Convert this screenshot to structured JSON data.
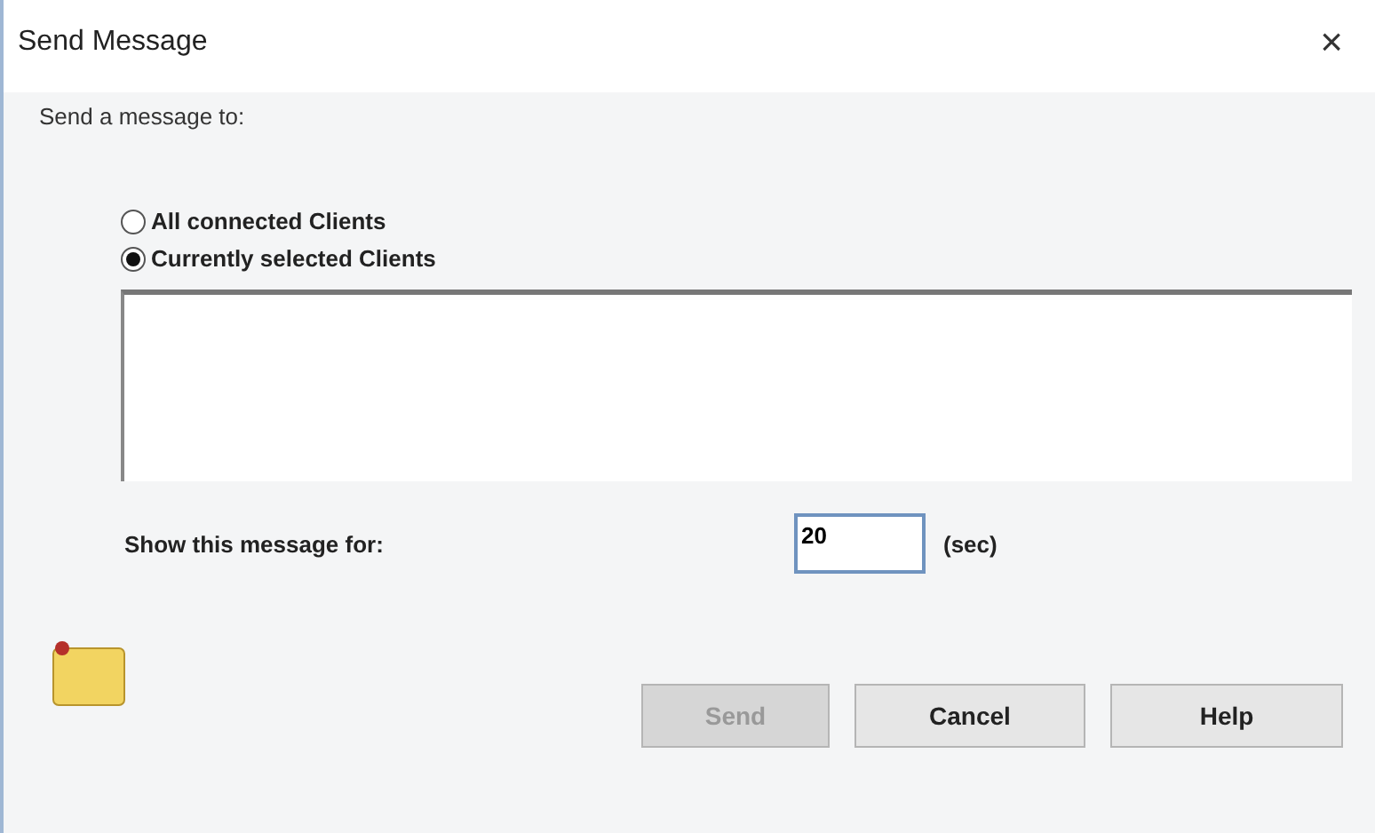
{
  "window": {
    "title": "Send Message",
    "close": "×"
  },
  "prompt": "Send a message to:",
  "recipients": [
    {
      "label": "All connected Clients",
      "selected": false
    },
    {
      "label": "Currently selected Clients",
      "selected": true
    }
  ],
  "duration": {
    "label": "Show this message for:",
    "value": "20",
    "unit": "(sec)"
  },
  "buttons": [
    {
      "label": "Send",
      "disabled": true
    },
    {
      "label": "Cancel",
      "disabled": false
    },
    {
      "label": "Help",
      "disabled": false
    }
  ]
}
